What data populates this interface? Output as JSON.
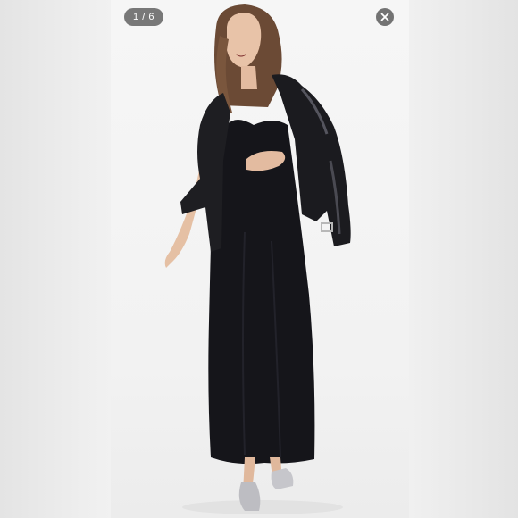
{
  "viewer": {
    "counter_text": "1 / 6",
    "close_icon": "close-icon"
  },
  "colors": {
    "backdrop": "#ffffff",
    "side_panels": "#e8e8e8",
    "photo_background": "#f3f3f3",
    "overlay_control": "#555555"
  }
}
